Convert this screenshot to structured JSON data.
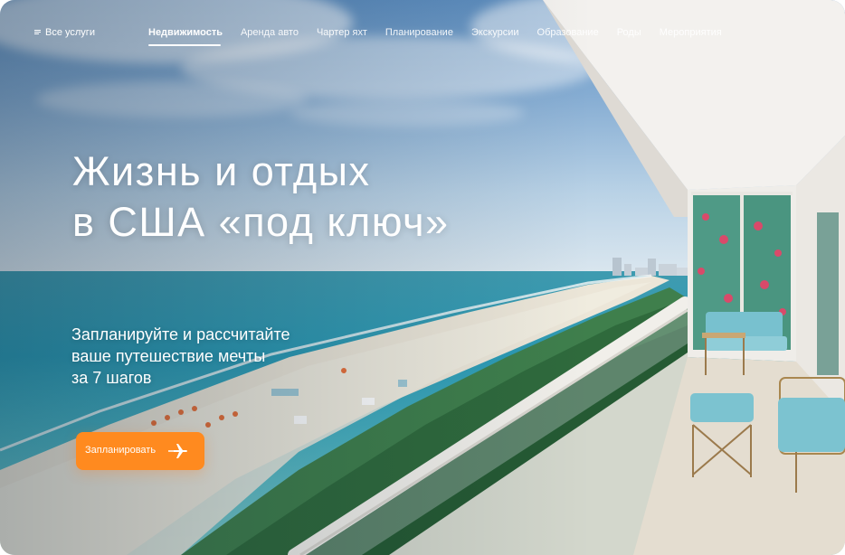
{
  "nav": {
    "all_services": "Все услуги",
    "menu_icon": "menu-icon",
    "links": [
      {
        "label": "Недвижимость",
        "active": true
      },
      {
        "label": "Аренда авто",
        "active": false
      },
      {
        "label": "Чартер яхт",
        "active": false
      },
      {
        "label": "Планирование",
        "active": false
      },
      {
        "label": "Экскурсии",
        "active": false
      },
      {
        "label": "Образование",
        "active": false
      },
      {
        "label": "Роды",
        "active": false
      },
      {
        "label": "Мероприятия",
        "active": false
      }
    ]
  },
  "hero": {
    "title_line1": "Жизнь и отдых",
    "title_line2": "в США «под ключ»",
    "subtitle_line1": "Запланируйте и рассчитайте",
    "subtitle_line2": "ваше путешествие мечты",
    "subtitle_line3": "за 7 шагов",
    "cta_label": "Запланировать",
    "cta_icon": "airplane-icon"
  },
  "colors": {
    "accent": "#ff8a1f",
    "text": "#ffffff"
  }
}
